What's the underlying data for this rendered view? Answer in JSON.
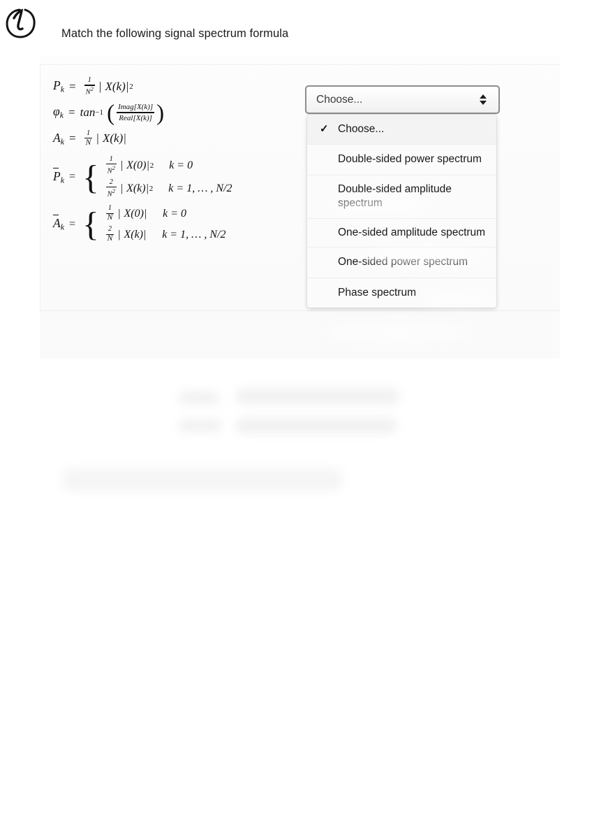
{
  "marker": {
    "glyph": "circled-one",
    "label": "1"
  },
  "question": {
    "title": "Match the following signal spectrum formula"
  },
  "formulas": [
    {
      "id": "power-spectrum",
      "lhs": "P",
      "lhs_sub": "k",
      "text": "P_k = 1/N^2 | X(k)|^2",
      "num": "1",
      "den": "N",
      "den_exp": "2",
      "body": "| X(k)|",
      "exp": "2"
    },
    {
      "id": "phase-spectrum",
      "lhs": "ϕ",
      "lhs_sub": "k",
      "text": "ϕ_k = tan^-1 ( Imag[X(k)] / Real[X(k)] )",
      "fn": "tan",
      "fn_exp": "−1",
      "frac_num": "Imag[X(k)]",
      "frac_den": "Real[X(k)]"
    },
    {
      "id": "amplitude-spectrum",
      "lhs": "A",
      "lhs_sub": "k",
      "text": "A_k = 1/N | X(k)|",
      "num": "1",
      "den": "N",
      "body": "| X(k)|"
    },
    {
      "id": "one-sided-power-spectrum",
      "lhs": "P",
      "lhs_sub": "k",
      "overbar": true,
      "text": "P̅_k = { 1/N^2 |X(0)|^2, k = 0 ; 2/N^2 |X(k)|^2, k = 1,...,N/2 }",
      "case1": {
        "num": "1",
        "den": "N",
        "den_exp": "2",
        "body": "| X(0)|",
        "exp": "2",
        "cond": "k = 0"
      },
      "case2": {
        "num": "2",
        "den": "N",
        "den_exp": "2",
        "body": "| X(k)|",
        "exp": "2",
        "cond": "k = 1, … , N/2"
      }
    },
    {
      "id": "one-sided-amplitude-spectrum",
      "lhs": "A",
      "lhs_sub": "k",
      "overbar": true,
      "text": "A̅_k = { 1/N |X(0)|, k = 0 ; 2/N |X(k)|, k = 1,...,N/2 }",
      "case1": {
        "num": "1",
        "den": "N",
        "body": "| X(0)|",
        "cond": "k = 0"
      },
      "case2": {
        "num": "2",
        "den": "N",
        "body": "| X(k)|",
        "cond": "k = 1, … , N/2"
      }
    }
  ],
  "select": {
    "value": "Choose...",
    "stepper_icon": "up-down-stepper-icon",
    "options": [
      {
        "label": "Choose...",
        "checked": true,
        "two_line": false
      },
      {
        "label": "Double-sided power spectrum",
        "checked": false,
        "two_line": false
      },
      {
        "label": "Double-sided amplitude spectrum",
        "checked": false,
        "two_line": true
      },
      {
        "label": "One-sided amplitude spectrum",
        "checked": false,
        "two_line": true
      },
      {
        "label": "One-sided power spectrum",
        "checked": false,
        "two_line": false
      },
      {
        "label": "Phase spectrum",
        "checked": false,
        "two_line": false
      }
    ],
    "check_glyph": "✓"
  },
  "redacted": {
    "note": "blurred illegible content below the question card"
  },
  "colors": {
    "page_background": "#ffffff",
    "panel_background": "#fbfbfb",
    "text": "#1b1b1b",
    "formula_text": "#14110f",
    "select_border": "#8d8d8d",
    "dropdown_background": "#fbfbfb",
    "dropdown_checked_background": "#f3f3f3",
    "divider": "#ededed"
  }
}
